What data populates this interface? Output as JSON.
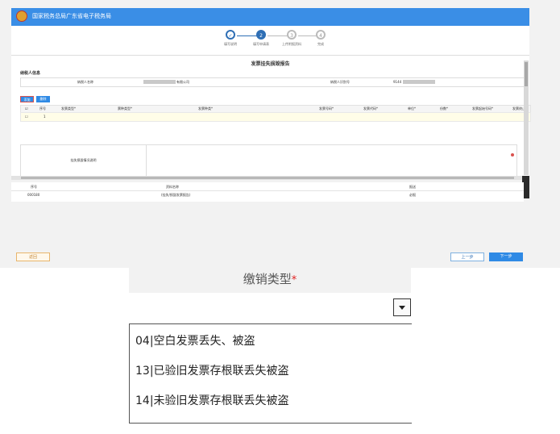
{
  "header": {
    "title": "国家税务总局广东省电子税务局"
  },
  "steps": [
    {
      "num": "✓",
      "label": "填写说明"
    },
    {
      "num": "2",
      "label": "填写申请表"
    },
    {
      "num": "3",
      "label": "上传附报资料"
    },
    {
      "num": "4",
      "label": "完成"
    }
  ],
  "form": {
    "title": "发票挂失损毁报告",
    "section_title": "纳税人信息",
    "taxpayer_name_label": "纳税人名称",
    "taxpayer_name_value": "有限公司",
    "taxpayer_id_label": "纳税人识别号",
    "taxpayer_id_value": "9144"
  },
  "toolbar": {
    "add_label": "添加",
    "delete_label": "删除"
  },
  "table": {
    "columns": [
      "序号",
      "发票类型*",
      "票种类型*",
      "发票种类*",
      "发票号码*",
      "发票代码*",
      "单位*",
      "份数*",
      "发票起始号码*",
      "发票终止"
    ],
    "row": {
      "index": "1"
    }
  },
  "note_label": "挂失损毁情况说明",
  "attachments": {
    "headers": [
      "序号",
      "资料名称",
      "报送"
    ],
    "row": [
      "000180",
      "(挂失/损毁发票报告)",
      "必报"
    ]
  },
  "footer": {
    "back_label": "返回",
    "prev_label": "上一步",
    "next_label": "下一步"
  },
  "dropdown": {
    "label": "缴销类型",
    "required_mark": "*",
    "options": [
      "04|空白发票丢失、被盗",
      "13|已验旧发票存根联丢失被盗",
      "14|未验旧发票存根联丢失被盗"
    ]
  },
  "colors": {
    "brand": "#3a8ee6",
    "primary": "#2f8ae5",
    "required": "#e02020"
  }
}
